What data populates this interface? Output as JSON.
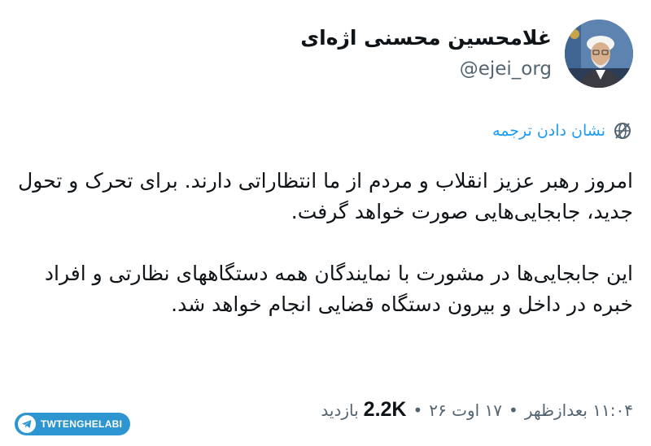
{
  "author": {
    "display_name": "غلامحسین محسنی اژه‌ای",
    "handle": "@ejei_org",
    "avatar_icon": "profile-photo"
  },
  "translate": {
    "label": "نشان دادن ترجمه",
    "icon": "globe-icon"
  },
  "tweet": {
    "paragraph_1": "امروز رهبر عزیز انقلاب و مردم از ما انتظاراتی دارند. برای تحرک و تحول جدید، جابجایی‌هایی صورت خواهد گرفت.",
    "paragraph_2": "این جابجایی‌ها در مشورت با نمایندگان همه دستگاههای نظارتی و افراد خبره در داخل و بیرون دستگاه قضایی انجام خواهد شد."
  },
  "meta": {
    "time": "۱۱:۰۴ بعدازظهر",
    "date": "۱۷ اوت ۲۶",
    "views_count": "2.2K",
    "views_label": "بازدید",
    "separator": "•"
  },
  "watermark": {
    "text": "TWTENGHELABI",
    "icon": "telegram-icon"
  },
  "colors": {
    "link": "#1d9bf0",
    "secondary_text": "#536471",
    "primary_text": "#0f1419",
    "watermark_bg": "#2d95cf"
  }
}
